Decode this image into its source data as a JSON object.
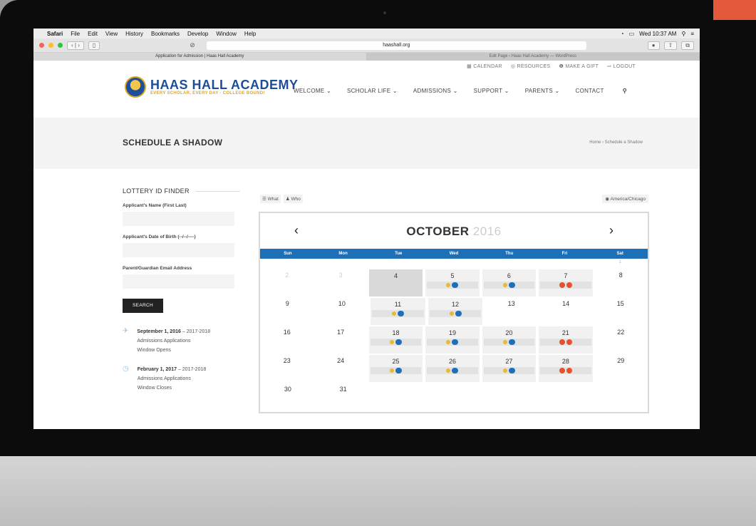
{
  "menubar": {
    "items": [
      "Safari",
      "File",
      "Edit",
      "View",
      "History",
      "Bookmarks",
      "Develop",
      "Window",
      "Help"
    ],
    "clock": "Wed 10:37 AM"
  },
  "browser": {
    "url": "haashall.org",
    "tabs": [
      "Application for Admission | Haas Hall Academy",
      "Edit Page ‹ Haas Hall Academy — WordPress"
    ]
  },
  "site": {
    "toplinks": [
      "CALENDAR",
      "RESOURCES",
      "MAKE A GIFT",
      "LOGOUT"
    ],
    "logo_name": "HAAS HALL ACADEMY",
    "logo_tagline": "EVERY SCHOLAR, EVERY DAY - COLLEGE BOUND!",
    "nav": [
      "WELCOME",
      "SCHOLAR LIFE",
      "ADMISSIONS",
      "SUPPORT",
      "PARENTS",
      "CONTACT"
    ],
    "page_title": "SCHEDULE A SHADOW",
    "breadcrumb": "Home › Schedule a Shadow"
  },
  "sidebar": {
    "title": "LOTTERY ID FINDER",
    "fields": [
      "Applicant's Name (First Last)",
      "Applicant's Date of Birth (--/--/----)",
      "Parent/Guardian Email Address"
    ],
    "search_label": "SEARCH",
    "events": [
      {
        "date": "September 1, 2016",
        "rest": " – 2017-2018",
        "line2": "Admissions Applications",
        "line3": "Window Opens"
      },
      {
        "date": "February 1, 2017",
        "rest": " – 2017-2018",
        "line2": "Admissions Applications",
        "line3": "Window Closes"
      }
    ]
  },
  "calendar": {
    "tools": [
      "What",
      "Who"
    ],
    "timezone": "America/Chicago",
    "month": "OCTOBER",
    "year": "2016",
    "prev": "‹",
    "next": "›",
    "dow": [
      "Sun",
      "Mon",
      "Tue",
      "Wed",
      "Thu",
      "Fri",
      "Sat"
    ],
    "first_row": [
      "",
      "",
      "",
      "",
      "",
      "",
      "1"
    ],
    "weeks": [
      [
        "2",
        "3",
        "4",
        "5",
        "6",
        "7",
        "8"
      ],
      [
        "9",
        "10",
        "11",
        "12",
        "13",
        "14",
        "15"
      ],
      [
        "16",
        "17",
        "18",
        "19",
        "20",
        "21",
        "22"
      ],
      [
        "23",
        "24",
        "25",
        "26",
        "27",
        "28",
        "29"
      ],
      [
        "30",
        "31",
        "",
        "",
        "",
        "",
        ""
      ]
    ],
    "colors": {
      "header": "#1d70b7",
      "yellow": "#e9b92c",
      "blue": "#1d70b7",
      "red": "#e2532d"
    }
  }
}
